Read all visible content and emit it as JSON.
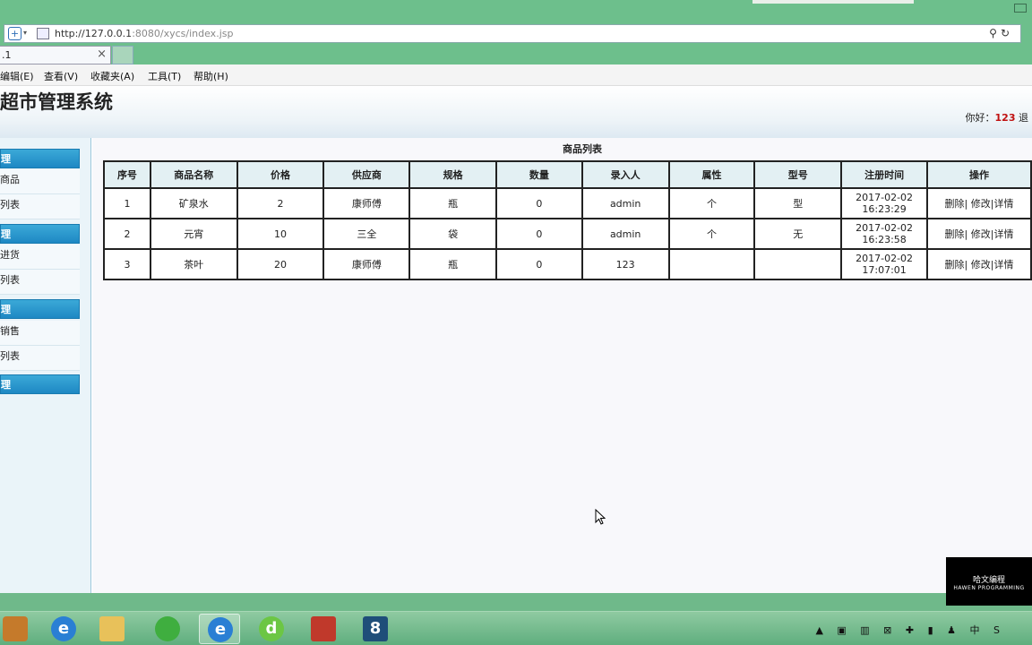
{
  "browser": {
    "url_host": "http://127.0.0.1",
    "url_path": ":8080/xycs/index.jsp",
    "tab_label": ".1",
    "tab_close": "×",
    "menu": [
      "编辑(E)",
      "查看(V)",
      "收藏夹(A)",
      "工具(T)",
      "帮助(H)"
    ]
  },
  "header": {
    "title": "超市管理系统",
    "greeting_prefix": "你好：",
    "user": "123",
    "greeting_suffix": "退"
  },
  "sidebar": {
    "sections": [
      {
        "title": "理",
        "items": [
          "商品",
          "列表"
        ]
      },
      {
        "title": "理",
        "items": [
          "进货",
          "列表"
        ]
      },
      {
        "title": "理",
        "items": [
          "销售",
          "列表"
        ]
      },
      {
        "title": "理",
        "items": []
      }
    ]
  },
  "content": {
    "list_title": "商品列表",
    "columns": [
      "序号",
      "商品名称",
      "价格",
      "供应商",
      "规格",
      "数量",
      "录入人",
      "属性",
      "型号",
      "注册时间",
      "操作"
    ],
    "rows": [
      [
        "1",
        "矿泉水",
        "2",
        "康师傅",
        "瓶",
        "0",
        "admin",
        "个",
        "型",
        "2017-02-02 16:23:29",
        "删除| 修改|详情"
      ],
      [
        "2",
        "元宵",
        "10",
        "三全",
        "袋",
        "0",
        "admin",
        "个",
        "无",
        "2017-02-02 16:23:58",
        "删除| 修改|详情"
      ],
      [
        "3",
        "茶叶",
        "20",
        "康师傅",
        "瓶",
        "0",
        "123",
        "",
        "",
        "2017-02-02 17:07:01",
        "删除| 修改|详情"
      ]
    ]
  },
  "watermark": {
    "line1": "哈文编程",
    "line2": "HAWEN PROGRAMMING"
  },
  "taskbar": {
    "apps": [
      "folder-app-icon",
      "ie-icon",
      "explorer-icon",
      "wechat-icon",
      "ie-active-icon",
      "dreamweaver-icon",
      "notepad-icon",
      "eclipse-icon"
    ],
    "tray_text": "中"
  },
  "colors": {
    "accent": "#1e88c4",
    "user_red": "#c01010",
    "taskbar": "#6dbf8c"
  }
}
